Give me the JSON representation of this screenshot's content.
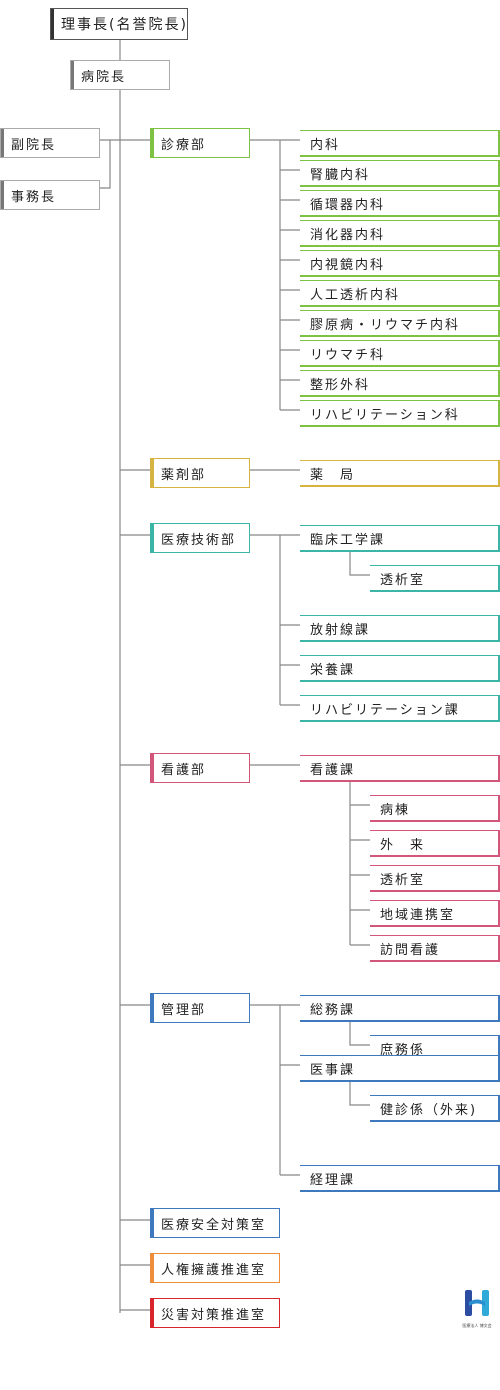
{
  "colors": {
    "gray": "#777777",
    "green": "#7dc242",
    "yellow": "#d6b441",
    "teal": "#3bb6a6",
    "pink": "#d2567a",
    "blue": "#3f79bd",
    "orange": "#ee8e3a",
    "red": "#d7252b",
    "line": "#888888"
  },
  "top": {
    "chairman": "理事長(名誉院長)",
    "director": "病院長",
    "vice_director": "副院長",
    "secretary": "事務長"
  },
  "departments": {
    "clinical": {
      "name": "診療部",
      "items": [
        "内科",
        "腎臓内科",
        "循環器内科",
        "消化器内科",
        "内視鏡内科",
        "人工透析内科",
        "膠原病・リウマチ内科",
        "リウマチ科",
        "整形外科",
        "リハビリテーション科"
      ]
    },
    "pharmacy": {
      "name": "薬剤部",
      "items": [
        "薬　局"
      ]
    },
    "technical": {
      "name": "医療技術部",
      "items": [
        "臨床工学課",
        "透析室",
        "放射線課",
        "栄養課",
        "リハビリテーション課"
      ]
    },
    "nursing": {
      "name": "看護部",
      "items": [
        "看護課",
        "病棟",
        "外　来",
        "透析室",
        "地域連携室",
        "訪問看護"
      ]
    },
    "admin": {
      "name": "管理部",
      "items": [
        "総務課",
        "庶務係",
        "医事課",
        "健診係（外来)",
        "経理課"
      ]
    }
  },
  "offices": [
    "医療安全対策室",
    "人権擁護推進室",
    "災害対策推進室"
  ],
  "logo": {
    "letter": "H",
    "caption": "医療法人 博文会"
  }
}
